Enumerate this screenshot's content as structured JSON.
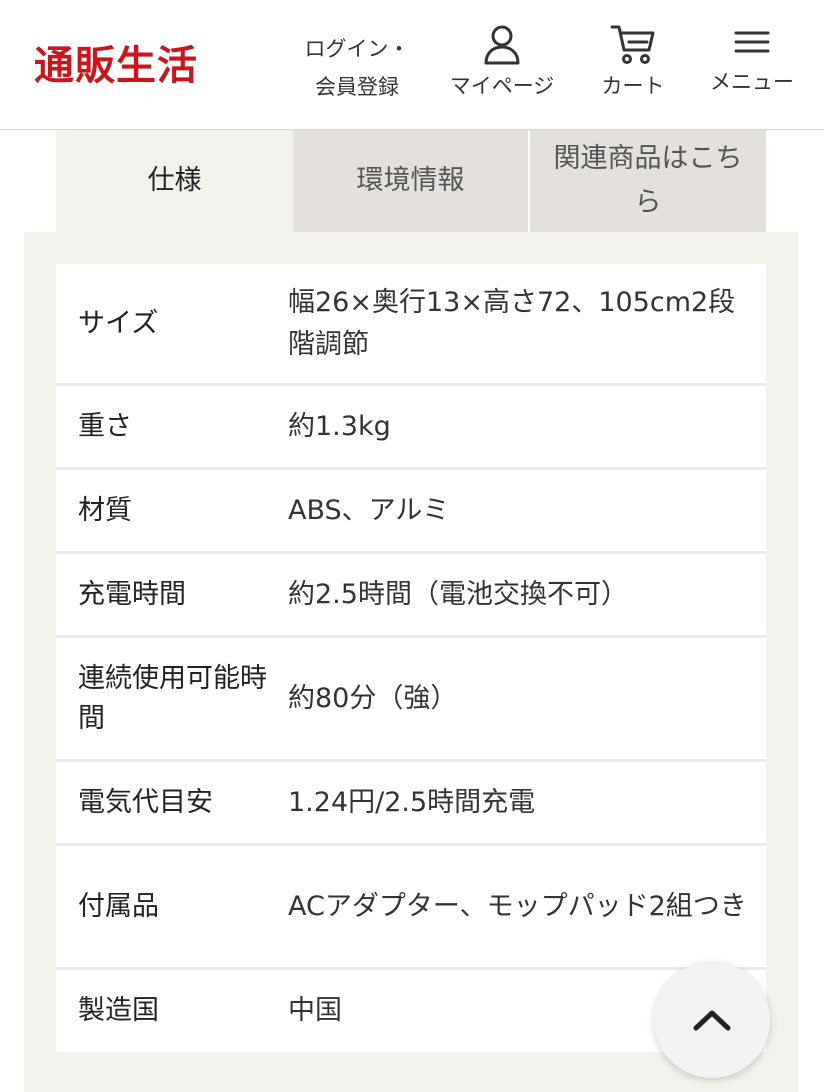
{
  "header": {
    "logo": "通販生活",
    "login_line1": "ログイン・",
    "login_line2": "会員登録",
    "mypage_label": "マイページ",
    "cart_label": "カート",
    "menu_label": "メニュー",
    "icons": {
      "mypage": "user-icon",
      "cart": "cart-icon",
      "menu": "hamburger-icon"
    }
  },
  "tabs": [
    {
      "label": "仕様",
      "active": true
    },
    {
      "label": "環境情報",
      "active": false
    },
    {
      "label": "関連商品はこちら",
      "active": false
    }
  ],
  "specs": [
    {
      "label": "サイズ",
      "value": "幅26×奥行13×高さ72、105cm2段階調節"
    },
    {
      "label": "重さ",
      "value": "約1.3kg"
    },
    {
      "label": "材質",
      "value": "ABS、アルミ"
    },
    {
      "label": "充電時間",
      "value": "約2.5時間（電池交換不可）"
    },
    {
      "label": "連続使用可能時間",
      "value": "約80分（強）"
    },
    {
      "label": "電気代目安",
      "value": "1.24円/2.5時間充電"
    },
    {
      "label": "付属品",
      "value": "ACアダプター、モップパッド2組つき"
    },
    {
      "label": "製造国",
      "value": "中国"
    }
  ],
  "back_to_top_icon": "chevron-up-icon",
  "colors": {
    "brand": "#c8161d",
    "panel_bg": "#f3f1ec",
    "inactive_tab_bg": "#e4e1dc"
  }
}
